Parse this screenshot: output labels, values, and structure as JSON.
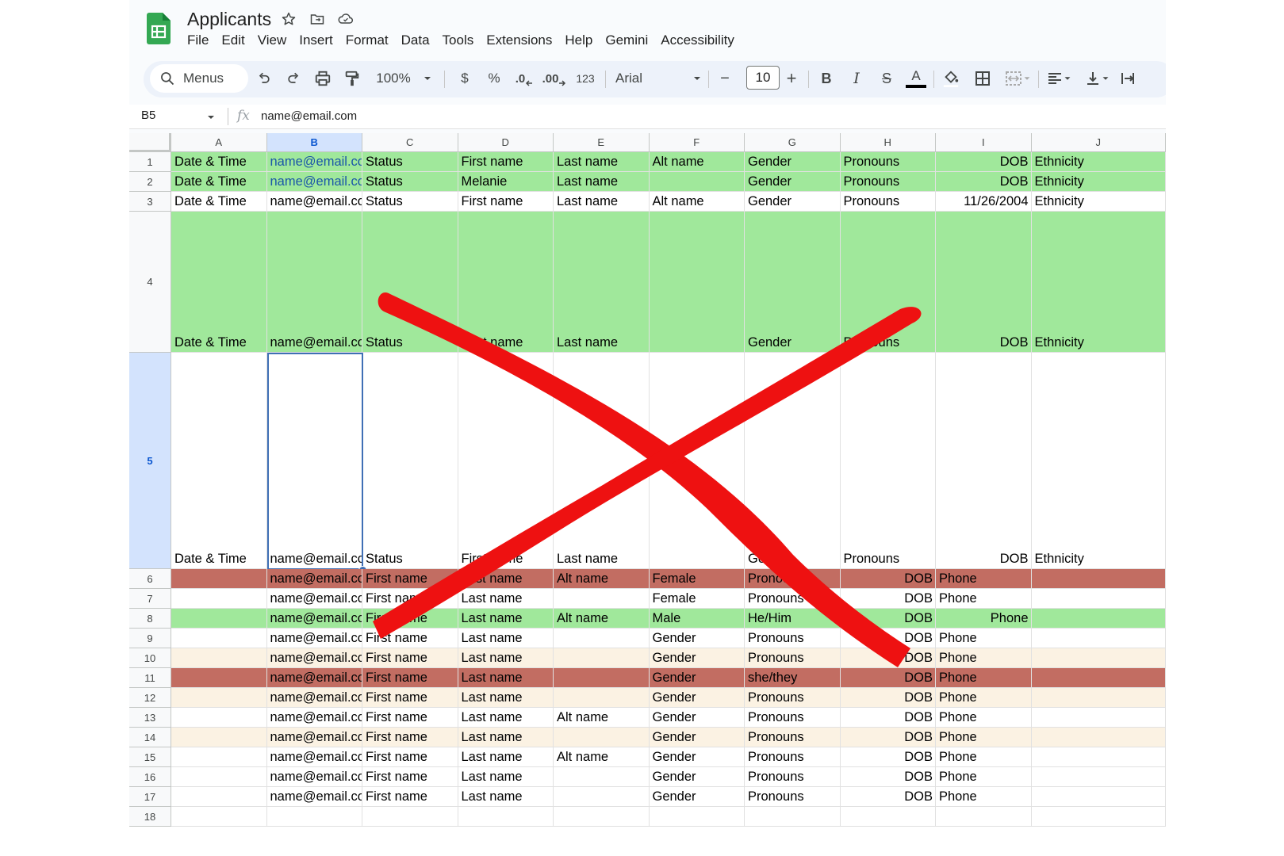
{
  "app": {
    "title": "Applicants",
    "menus": [
      "File",
      "Edit",
      "View",
      "Insert",
      "Format",
      "Data",
      "Tools",
      "Extensions",
      "Help",
      "Gemini",
      "Accessibility"
    ]
  },
  "toolbar": {
    "search_label": "Menus",
    "zoom": "100%",
    "currency": "$",
    "percent": "%",
    "dec_decrease": ".0",
    "dec_increase": ".00",
    "number_format": "123",
    "font": "Arial",
    "font_size": "10",
    "minus": "−",
    "plus": "+",
    "bold": "B",
    "italic": "I",
    "strike": "S",
    "text_color": "A"
  },
  "formula_bar": {
    "cell_ref": "B5",
    "fx": "fx",
    "content": "name@email.com"
  },
  "columns": [
    "A",
    "B",
    "C",
    "D",
    "E",
    "F",
    "G",
    "H",
    "I",
    "J"
  ],
  "selected_column": "B",
  "rows": [
    {
      "num": "1",
      "bg": "green",
      "cells": [
        "Date & Time",
        "name@email.com",
        "Status",
        "First name",
        "Last name",
        "Alt name",
        "Gender",
        "Pronouns",
        "DOB",
        "Ethnicity"
      ]
    },
    {
      "num": "2",
      "bg": "green",
      "cells": [
        "Date & Time",
        "name@email.com",
        "Status",
        "Melanie",
        "Last name",
        "",
        "Gender",
        "Pronouns",
        "DOB",
        "Ethnicity"
      ]
    },
    {
      "num": "3",
      "bg": "white",
      "cells": [
        "Date & Time",
        "name@email.com",
        "Status",
        "First name",
        "Last name",
        "Alt name",
        "Gender",
        "Pronouns",
        "11/26/2004",
        "Ethnicity"
      ]
    },
    {
      "num": "4",
      "bg": "green",
      "cells": [
        "Date & Time",
        "name@email.com",
        "Status",
        "First name",
        "Last name",
        "",
        "Gender",
        "Pronouns",
        "DOB",
        "Ethnicity"
      ]
    },
    {
      "num": "5",
      "bg": "white",
      "cells": [
        "Date & Time",
        "name@email.com",
        "Status",
        "First name",
        "Last name",
        "",
        "Gender",
        "Pronouns",
        "DOB",
        "Ethnicity"
      ]
    },
    {
      "num": "6",
      "bg": "red",
      "cells": [
        "",
        "name@email.com",
        "First name",
        "Last name",
        "Alt name",
        "Female",
        "Pronouns",
        "DOB",
        "Phone",
        ""
      ]
    },
    {
      "num": "7",
      "bg": "white",
      "cells": [
        "",
        "name@email.com",
        "First name",
        "Last name",
        "",
        "Female",
        "Pronouns",
        "DOB",
        "Phone",
        ""
      ]
    },
    {
      "num": "8",
      "bg": "green",
      "cells": [
        "",
        "name@email.com",
        "First name",
        "Last name",
        "Alt name",
        "Male",
        "He/Him",
        "DOB",
        "Phone",
        ""
      ]
    },
    {
      "num": "9",
      "bg": "white",
      "cells": [
        "",
        "name@email.com",
        "First name",
        "Last name",
        "",
        "Gender",
        "Pronouns",
        "DOB",
        "Phone",
        ""
      ]
    },
    {
      "num": "10",
      "bg": "cream",
      "cells": [
        "",
        "name@email.com",
        "First name",
        "Last name",
        "",
        "Gender",
        "Pronouns",
        "DOB",
        "Phone",
        ""
      ]
    },
    {
      "num": "11",
      "bg": "red",
      "cells": [
        "",
        "name@email.com",
        "First name",
        "Last name",
        "",
        "Gender",
        "she/they",
        "DOB",
        "Phone",
        ""
      ]
    },
    {
      "num": "12",
      "bg": "cream",
      "cells": [
        "",
        "name@email.com",
        "First name",
        "Last name",
        "",
        "Gender",
        "Pronouns",
        "DOB",
        "Phone",
        ""
      ]
    },
    {
      "num": "13",
      "bg": "white",
      "cells": [
        "",
        "name@email.com",
        "First name",
        "Last name",
        "Alt name",
        "Gender",
        "Pronouns",
        "DOB",
        "Phone",
        ""
      ]
    },
    {
      "num": "14",
      "bg": "cream",
      "cells": [
        "",
        "name@email.com",
        "First name",
        "Last name",
        "",
        "Gender",
        "Pronouns",
        "DOB",
        "Phone",
        ""
      ]
    },
    {
      "num": "15",
      "bg": "white",
      "cells": [
        "",
        "name@email.com",
        "First name",
        "Last name",
        "Alt name",
        "Gender",
        "Pronouns",
        "DOB",
        "Phone",
        ""
      ]
    },
    {
      "num": "16",
      "bg": "white",
      "cells": [
        "",
        "name@email.com",
        "First name",
        "Last name",
        "",
        "Gender",
        "Pronouns",
        "DOB",
        "Phone",
        ""
      ]
    },
    {
      "num": "17",
      "bg": "white",
      "cells": [
        "",
        "name@email.com",
        "First name",
        "Last name",
        "",
        "Gender",
        "Pronouns",
        "DOB",
        "Phone",
        ""
      ]
    },
    {
      "num": "18",
      "bg": "white",
      "cells": [
        "",
        "",
        "",
        "",
        "",
        "",
        "",
        "",
        "",
        ""
      ]
    }
  ],
  "selected_cell": "B5",
  "colors": {
    "green": "#a0e89b",
    "red": "#c26d62",
    "cream": "#fbf2e3",
    "selection": "#3f6fb5",
    "overlay_x": "#ee1111"
  },
  "overlay": "red-x-mark"
}
